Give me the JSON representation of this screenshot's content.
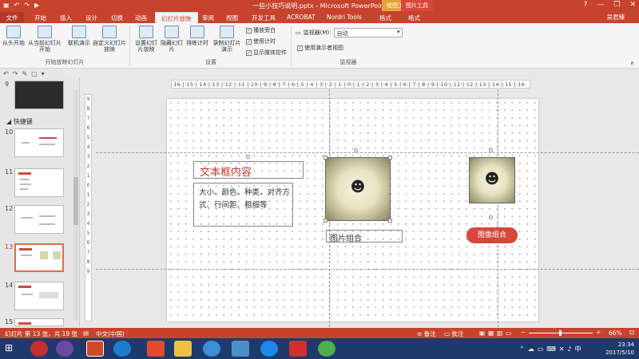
{
  "window": {
    "title": "一些小技巧说明.pptx - Microsoft PowerPoint",
    "ctx_drawing": "绘图工具",
    "ctx_picture": "图片工具",
    "user": "吴君臻"
  },
  "qat": {
    "icons": [
      "save-icon",
      "undo-icon",
      "redo-icon",
      "start-icon"
    ]
  },
  "tabs": [
    {
      "label": "文件"
    },
    {
      "label": "开始"
    },
    {
      "label": "插入"
    },
    {
      "label": "设计"
    },
    {
      "label": "切换"
    },
    {
      "label": "动画"
    },
    {
      "label": "幻灯片放映"
    },
    {
      "label": "审阅"
    },
    {
      "label": "视图"
    },
    {
      "label": "开发工具"
    },
    {
      "label": "ACROBAT"
    },
    {
      "label": "Nordri Tools"
    },
    {
      "label": "格式"
    },
    {
      "label": "格式"
    }
  ],
  "ribbon": {
    "start": {
      "from_begin": "从头开始",
      "from_current": "从当前幻灯片开始",
      "online": "联机演示",
      "custom": "自定义幻灯片放映",
      "group": "开始放映幻灯片"
    },
    "setup": {
      "setup_show": "设置幻灯片放映",
      "hide": "隐藏幻灯片",
      "rehearse": "排练计时",
      "record": "录制幻灯片演示",
      "play_narr": "播放旁白",
      "use_timing": "使用计时",
      "show_media": "显示媒体控件",
      "group": "设置"
    },
    "monitor": {
      "monitor_label": "监视器(M):",
      "monitor_value": "自动",
      "presenter": "使用演示者视图",
      "group": "监视器"
    }
  },
  "ruler": {
    "h_text": "·16·|·15·|·14·|·13·|·12·|·11·|·10·|·9·|·8·|·7·|·6·|·5·|·4·|·3·|·2·|·1·|·0·|·1·|·2·|·3·|·4·|·5·|·6·|·7·|·8·|·9·|·10·|·11·|·12·|·13·|·14·|·15·|·16·",
    "v_text": "9 8 7 6 5 4 3 2 1 0 1 2 3 4 5 6 7 8 9"
  },
  "slides": {
    "section": "快捷键",
    "nums": [
      "9",
      "10",
      "11",
      "12",
      "13",
      "14",
      "15"
    ]
  },
  "canvas": {
    "title_text": "文本框内容",
    "body_text": "大小、颜色、种类、对齐方式、行间距、粗细等",
    "img_label": "图片组合",
    "pill_label": "图像组合"
  },
  "status": {
    "slide_info": "幻灯片 第 13 张，共 19 张",
    "lang": "中文(中国)",
    "notes": "备注",
    "comments": "批注",
    "zoom": "66%"
  },
  "taskbar": {
    "time": "23:34",
    "date": "2017/5/10"
  }
}
